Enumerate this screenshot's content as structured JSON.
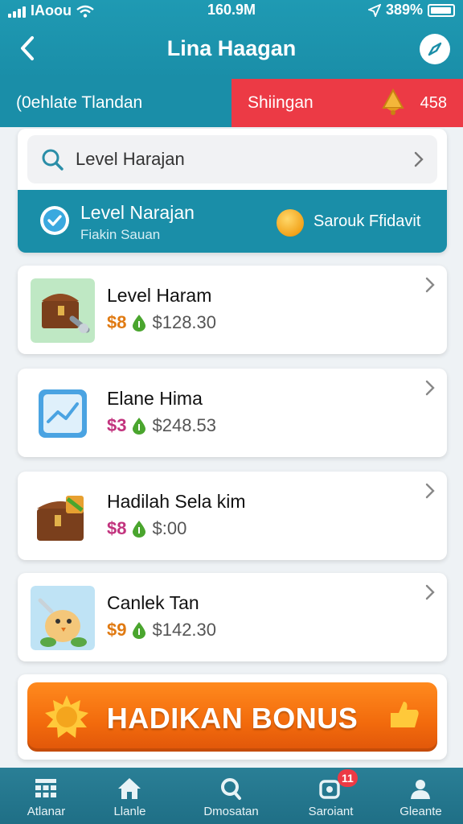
{
  "status_bar": {
    "carrier": "IAoou",
    "time": "160.9M",
    "battery": "389%"
  },
  "header": {
    "title": "Lina Haagan"
  },
  "tabs": {
    "left_label": "(0ehlate Tlandan",
    "right_label": "Shiingan",
    "right_count": "458"
  },
  "search": {
    "text": "Level Harajan"
  },
  "level_banner": {
    "title": "Level Narajan",
    "subtitle": "Fiakin Sauan",
    "right_text": "Sarouk Ffidavit"
  },
  "items": [
    {
      "name": "Level Haram",
      "price_a": "$8",
      "price_b": "$128.30",
      "price_a_color": "#e07a12",
      "icon": "treasure-chest-icon"
    },
    {
      "name": "Elane Hima",
      "price_a": "$3",
      "price_b": "$248.53",
      "price_a_color": "#c2337e",
      "icon": "chart-tile-icon"
    },
    {
      "name": "Hadilah Sela kim",
      "price_a": "$8",
      "price_b": "$:00",
      "price_a_color": "#c2337e",
      "icon": "gift-chest-icon"
    },
    {
      "name": "Canlek Tan",
      "price_a": "$9",
      "price_b": "$142.30",
      "price_a_color": "#e07a12",
      "icon": "chicken-chef-icon"
    }
  ],
  "bonus_button": {
    "label": "HADIKAN BONUS"
  },
  "bottom_nav": [
    {
      "label": "Atlanar",
      "icon": "grid-icon"
    },
    {
      "label": "Llanle",
      "icon": "home-icon"
    },
    {
      "label": "Dmosatan",
      "icon": "search-icon"
    },
    {
      "label": "Saroiant",
      "icon": "notification-icon",
      "badge": "11"
    },
    {
      "label": "Gleante",
      "icon": "profile-icon"
    }
  ],
  "colors": {
    "primary": "#1a8ea8",
    "accent_red": "#ec3a45",
    "bonus_orange": "#f26a0c",
    "drop_green": "#4aa52e"
  }
}
